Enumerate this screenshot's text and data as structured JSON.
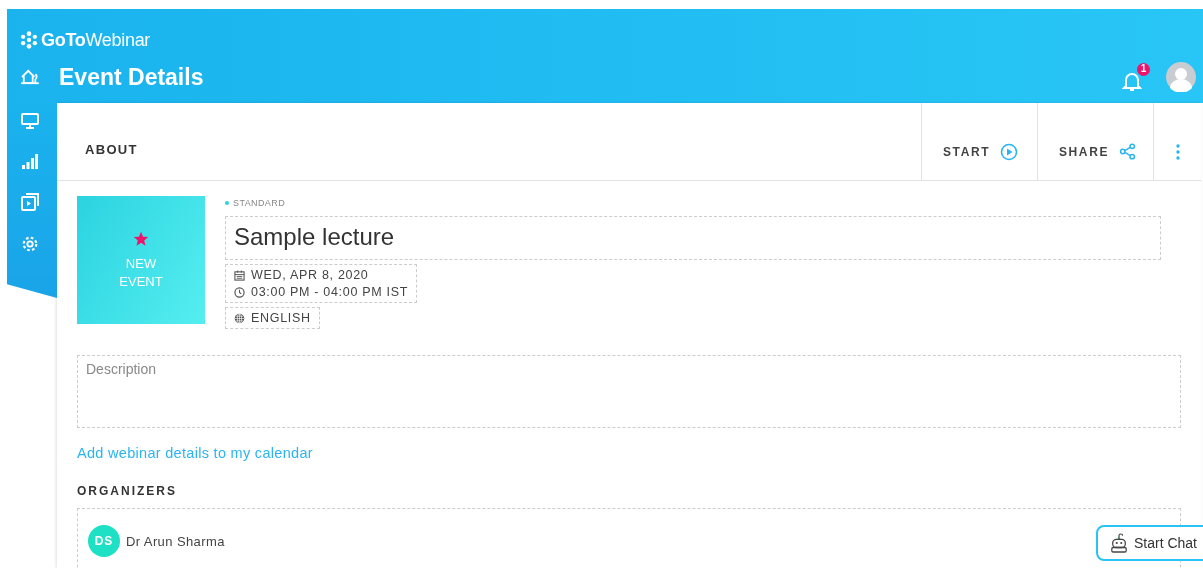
{
  "header": {
    "logo": "**GoTo**Webinar",
    "title": "Event Details",
    "notifications": "1"
  },
  "card": {
    "section": "ABOUT",
    "actions": [
      {
        "kind": "start",
        "label": "START"
      },
      {
        "kind": "share",
        "label": "SHARE"
      },
      {
        "kind": "more"
      }
    ]
  },
  "event": {
    "thumbnail": [
      "NEW",
      "EVENT"
    ],
    "type": "STANDARD",
    "name": "Sample lecture",
    "date": "WED, APR 8, 2020",
    "time": "03:00 PM - 04:00 PM IST",
    "language": "ENGLISH"
  },
  "description": {
    "placeholder": "Description"
  },
  "calendar_link": "Add webinar details to my calendar",
  "organizers": {
    "heading": "ORGANIZERS",
    "people": [
      {
        "initials": "DS",
        "name": "Dr Arun Sharma"
      }
    ]
  },
  "chat_button": "Start Chat"
}
